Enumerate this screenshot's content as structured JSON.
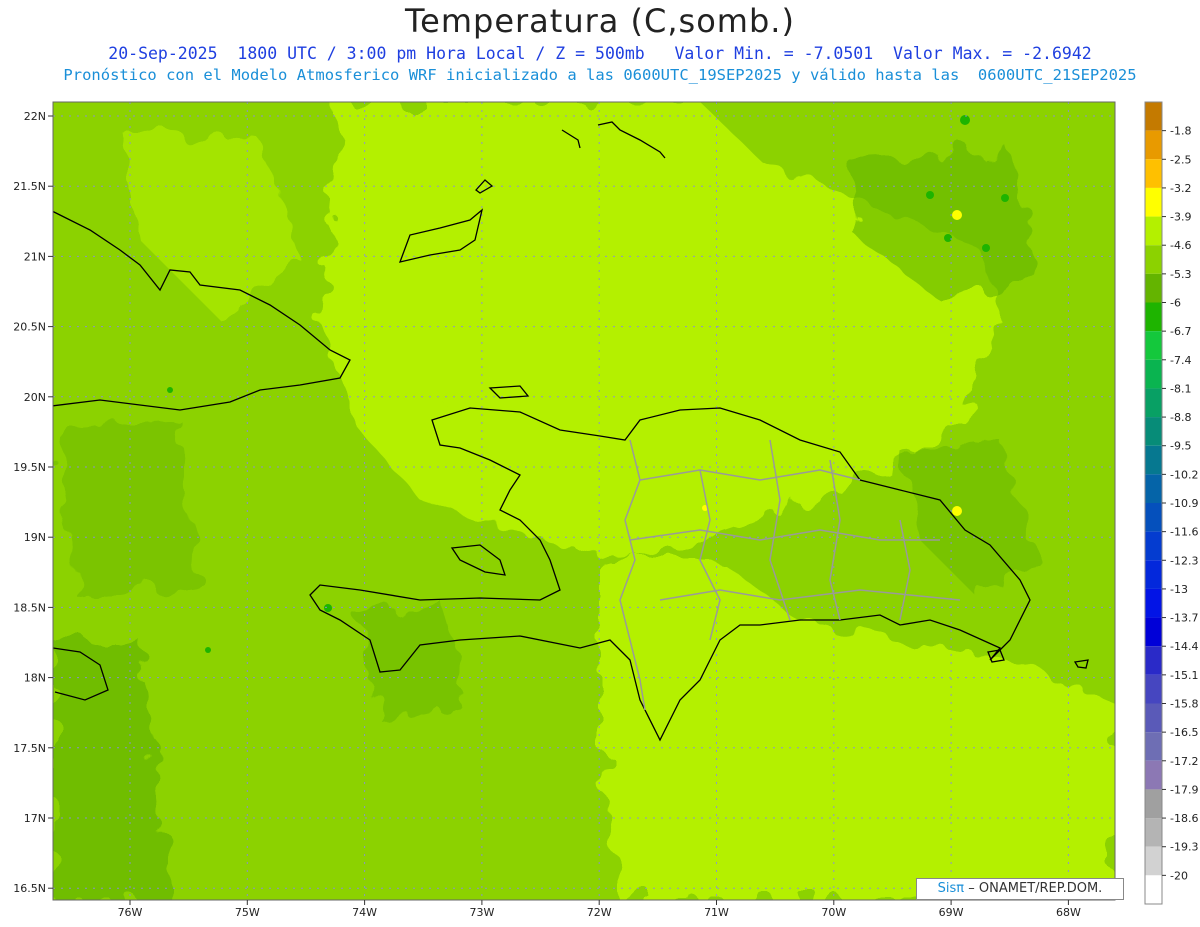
{
  "header": {
    "title": "Temperatura (C,somb.)",
    "line1": "20-Sep-2025  1800 UTC / 3:00 pm Hora Local / Z = 500mb   Valor Min. = -7.0501  Valor Max. = -2.6942",
    "line2": "Pronóstico con el Modelo Atmosferico WRF inicializado a las 0600UTC_19SEP2025 y válido hasta las  0600UTC_21SEP2025"
  },
  "axes": {
    "lat_labels": [
      "22N",
      "21.5N",
      "21N",
      "20.5N",
      "20N",
      "19.5N",
      "19N",
      "18.5N",
      "18N",
      "17.5N",
      "17N",
      "16.5N"
    ],
    "lon_labels": [
      "76W",
      "75W",
      "74W",
      "73W",
      "72W",
      "71W",
      "70W",
      "69W",
      "68W"
    ]
  },
  "colorbar": {
    "labels": [
      "-1.8",
      "-2.5",
      "-3.2",
      "-3.9",
      "-4.6",
      "-5.3",
      "-6",
      "-6.7",
      "-7.4",
      "-8.1",
      "-8.8",
      "-9.5",
      "-10.2",
      "-10.9",
      "-11.6",
      "-12.3",
      "-13",
      "-13.7",
      "-14.4",
      "-15.1",
      "-15.8",
      "-16.5",
      "-17.2",
      "-17.9",
      "-18.6",
      "-19.3",
      "-20"
    ],
    "colors": [
      "#c47a00",
      "#e89a00",
      "#ffc000",
      "#ffff00",
      "#b4f000",
      "#8cd200",
      "#64b400",
      "#1eb400",
      "#14c83c",
      "#0ab450",
      "#08a064",
      "#078c78",
      "#067890",
      "#0564a8",
      "#0550bc",
      "#043cd0",
      "#0328dc",
      "#0214e6",
      "#0000d8",
      "#2a2ac8",
      "#4646c0",
      "#5a5ab8",
      "#6e6eb4",
      "#8c78b4",
      "#a0a0a0",
      "#b4b4b4",
      "#d2d2d2",
      "#ffffff"
    ]
  },
  "credit": {
    "brand": "Sisπ",
    "text": "– ONAMET/REP.DOM."
  }
}
